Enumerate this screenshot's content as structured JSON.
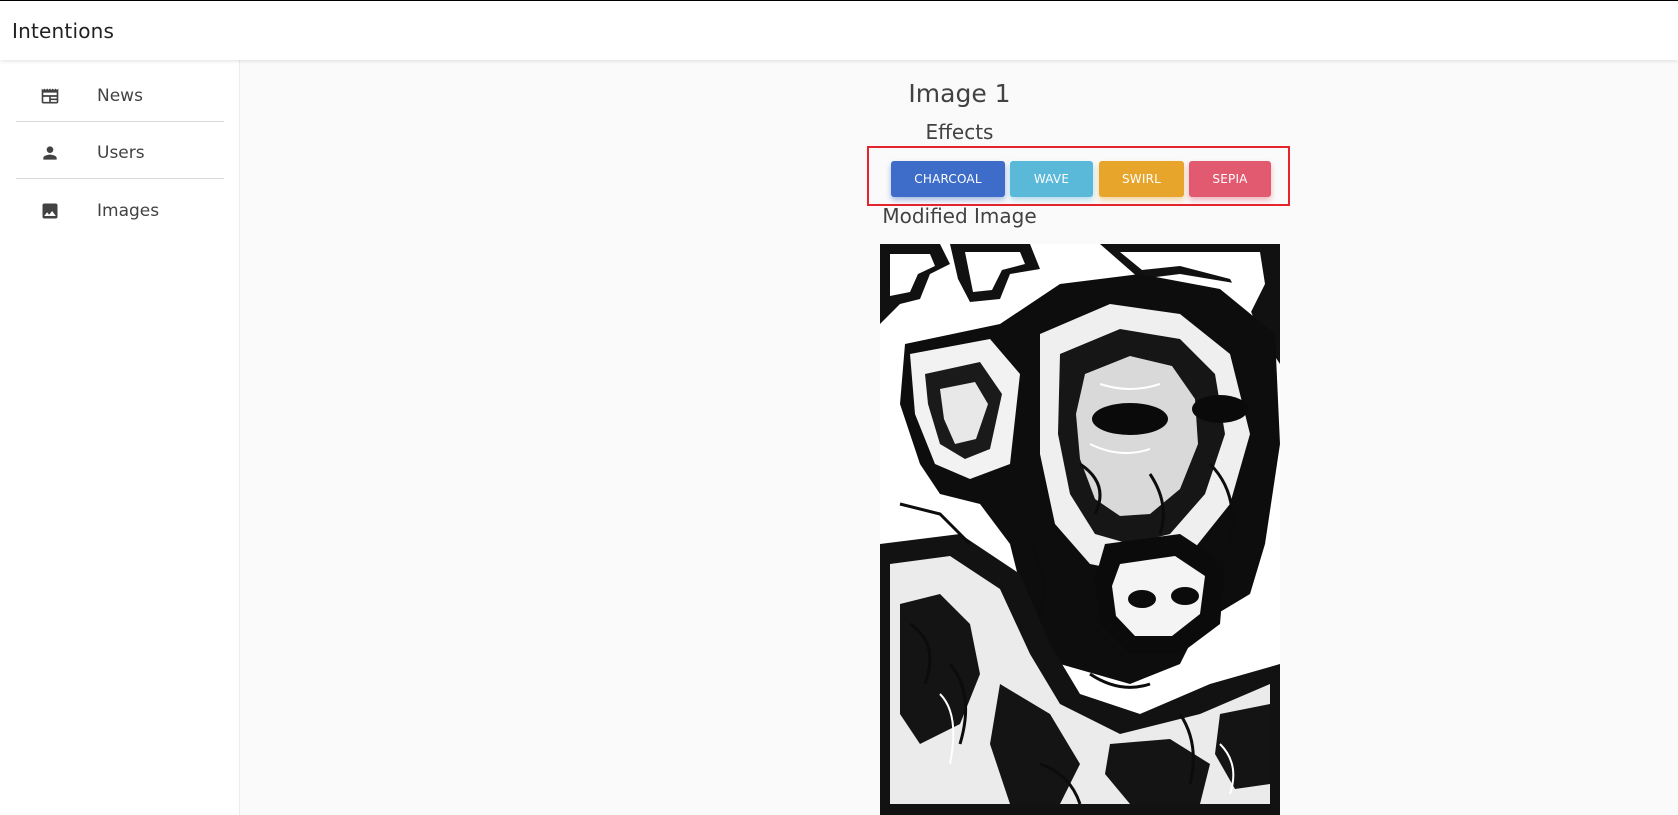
{
  "app": {
    "title": "Intentions"
  },
  "sidebar": {
    "items": [
      {
        "label": "News",
        "icon": "newspaper-icon"
      },
      {
        "label": "Users",
        "icon": "person-icon"
      },
      {
        "label": "Images",
        "icon": "image-icon"
      }
    ]
  },
  "main": {
    "image_title": "Image 1",
    "effects_title": "Effects",
    "buttons": {
      "charcoal": "CHARCOAL",
      "wave": "WAVE",
      "swirl": "SWIRL",
      "sepia": "SEPIA"
    },
    "modified_title": "Modified Image"
  },
  "colors": {
    "charcoal": "#3d6cc9",
    "wave": "#5ab8d8",
    "swirl": "#e8a52c",
    "sepia": "#e25a6f",
    "highlight": "#e5242b"
  }
}
